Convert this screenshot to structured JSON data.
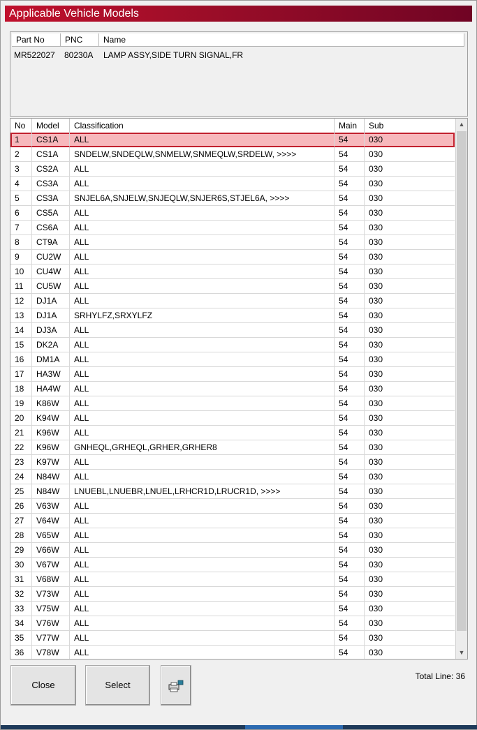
{
  "window": {
    "title": "Applicable Vehicle Models"
  },
  "part_info": {
    "headers": [
      "Part No",
      "PNC",
      "Name"
    ],
    "part_no": "MR522027",
    "pnc": "80230A",
    "name": "LAMP ASSY,SIDE TURN SIGNAL,FR"
  },
  "list": {
    "headers": [
      "No",
      "Model",
      "Classification",
      "Main",
      "Sub"
    ],
    "selected_row": 1,
    "rows": [
      {
        "no": "1",
        "model": "CS1A",
        "classification": "ALL",
        "main": "54",
        "sub": "030"
      },
      {
        "no": "2",
        "model": "CS1A",
        "classification": "SNDELW,SNDEQLW,SNMELW,SNMEQLW,SRDELW,  >>>>",
        "main": "54",
        "sub": "030"
      },
      {
        "no": "3",
        "model": "CS2A",
        "classification": "ALL",
        "main": "54",
        "sub": "030"
      },
      {
        "no": "4",
        "model": "CS3A",
        "classification": "ALL",
        "main": "54",
        "sub": "030"
      },
      {
        "no": "5",
        "model": "CS3A",
        "classification": "SNJEL6A,SNJELW,SNJEQLW,SNJER6S,STJEL6A,  >>>>",
        "main": "54",
        "sub": "030"
      },
      {
        "no": "6",
        "model": "CS5A",
        "classification": "ALL",
        "main": "54",
        "sub": "030"
      },
      {
        "no": "7",
        "model": "CS6A",
        "classification": "ALL",
        "main": "54",
        "sub": "030"
      },
      {
        "no": "8",
        "model": "CT9A",
        "classification": "ALL",
        "main": "54",
        "sub": "030"
      },
      {
        "no": "9",
        "model": "CU2W",
        "classification": "ALL",
        "main": "54",
        "sub": "030"
      },
      {
        "no": "10",
        "model": "CU4W",
        "classification": "ALL",
        "main": "54",
        "sub": "030"
      },
      {
        "no": "11",
        "model": "CU5W",
        "classification": "ALL",
        "main": "54",
        "sub": "030"
      },
      {
        "no": "12",
        "model": "DJ1A",
        "classification": "ALL",
        "main": "54",
        "sub": "030"
      },
      {
        "no": "13",
        "model": "DJ1A",
        "classification": "SRHYLFZ,SRXYLFZ",
        "main": "54",
        "sub": "030"
      },
      {
        "no": "14",
        "model": "DJ3A",
        "classification": "ALL",
        "main": "54",
        "sub": "030"
      },
      {
        "no": "15",
        "model": "DK2A",
        "classification": "ALL",
        "main": "54",
        "sub": "030"
      },
      {
        "no": "16",
        "model": "DM1A",
        "classification": "ALL",
        "main": "54",
        "sub": "030"
      },
      {
        "no": "17",
        "model": "HA3W",
        "classification": "ALL",
        "main": "54",
        "sub": "030"
      },
      {
        "no": "18",
        "model": "HA4W",
        "classification": "ALL",
        "main": "54",
        "sub": "030"
      },
      {
        "no": "19",
        "model": "K86W",
        "classification": "ALL",
        "main": "54",
        "sub": "030"
      },
      {
        "no": "20",
        "model": "K94W",
        "classification": "ALL",
        "main": "54",
        "sub": "030"
      },
      {
        "no": "21",
        "model": "K96W",
        "classification": "ALL",
        "main": "54",
        "sub": "030"
      },
      {
        "no": "22",
        "model": "K96W",
        "classification": "GNHEQL,GRHEQL,GRHER,GRHER8",
        "main": "54",
        "sub": "030"
      },
      {
        "no": "23",
        "model": "K97W",
        "classification": "ALL",
        "main": "54",
        "sub": "030"
      },
      {
        "no": "24",
        "model": "N84W",
        "classification": "ALL",
        "main": "54",
        "sub": "030"
      },
      {
        "no": "25",
        "model": "N84W",
        "classification": "LNUEBL,LNUEBR,LNUEL,LRHCR1D,LRUCR1D,  >>>>",
        "main": "54",
        "sub": "030"
      },
      {
        "no": "26",
        "model": "V63W",
        "classification": "ALL",
        "main": "54",
        "sub": "030"
      },
      {
        "no": "27",
        "model": "V64W",
        "classification": "ALL",
        "main": "54",
        "sub": "030"
      },
      {
        "no": "28",
        "model": "V65W",
        "classification": "ALL",
        "main": "54",
        "sub": "030"
      },
      {
        "no": "29",
        "model": "V66W",
        "classification": "ALL",
        "main": "54",
        "sub": "030"
      },
      {
        "no": "30",
        "model": "V67W",
        "classification": "ALL",
        "main": "54",
        "sub": "030"
      },
      {
        "no": "31",
        "model": "V68W",
        "classification": "ALL",
        "main": "54",
        "sub": "030"
      },
      {
        "no": "32",
        "model": "V73W",
        "classification": "ALL",
        "main": "54",
        "sub": "030"
      },
      {
        "no": "33",
        "model": "V75W",
        "classification": "ALL",
        "main": "54",
        "sub": "030"
      },
      {
        "no": "34",
        "model": "V76W",
        "classification": "ALL",
        "main": "54",
        "sub": "030"
      },
      {
        "no": "35",
        "model": "V77W",
        "classification": "ALL",
        "main": "54",
        "sub": "030"
      },
      {
        "no": "36",
        "model": "V78W",
        "classification": "ALL",
        "main": "54",
        "sub": "030"
      }
    ]
  },
  "buttons": {
    "close_label": "Close",
    "select_label": "Select",
    "print_icon": "printer-icon"
  },
  "footer": {
    "total_line": "Total Line: 36"
  },
  "colors": {
    "title_bar": "#9a0d28",
    "selected_row_bg": "#f7b8bc",
    "selected_row_border": "#c2202e"
  }
}
